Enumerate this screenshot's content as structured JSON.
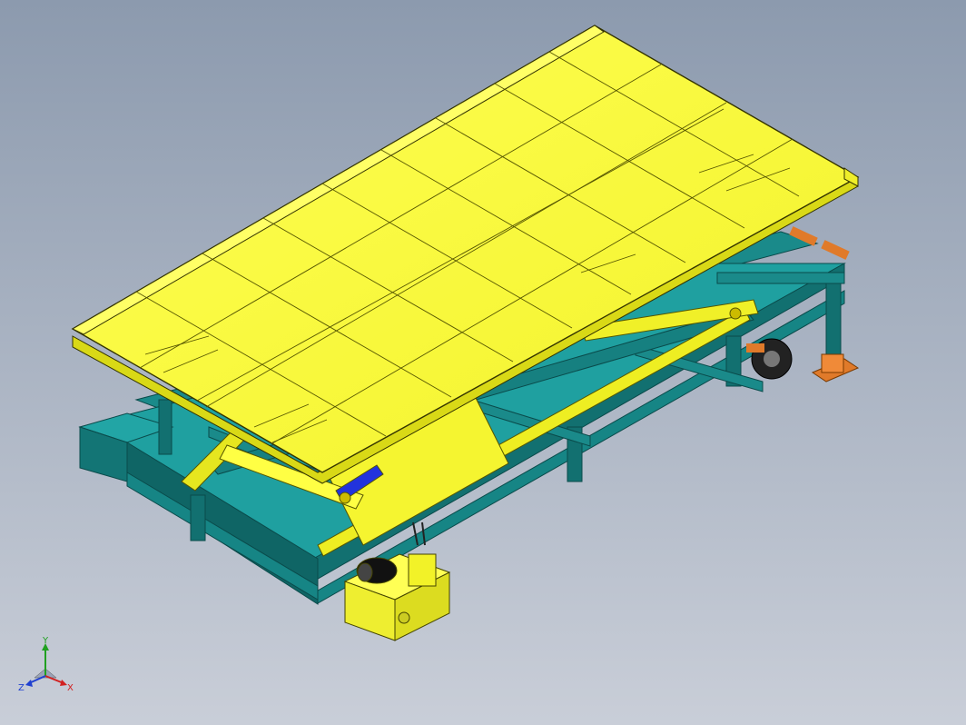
{
  "viewport": {
    "background_top": "#8c9aae",
    "background_bottom": "#c9ced8"
  },
  "model": {
    "platform_color": "#ffff33",
    "frame_color": "#1a8a8a",
    "frame_shadow": "#0f5f60",
    "cylinder_color": "#2233dd",
    "pad_color": "#e07a2a",
    "wheel_color": "#222222"
  },
  "triad": {
    "x_label": "X",
    "y_label": "Y",
    "z_label": "Z",
    "x_color": "#d22020",
    "y_color": "#20a020",
    "z_color": "#2040d0"
  }
}
